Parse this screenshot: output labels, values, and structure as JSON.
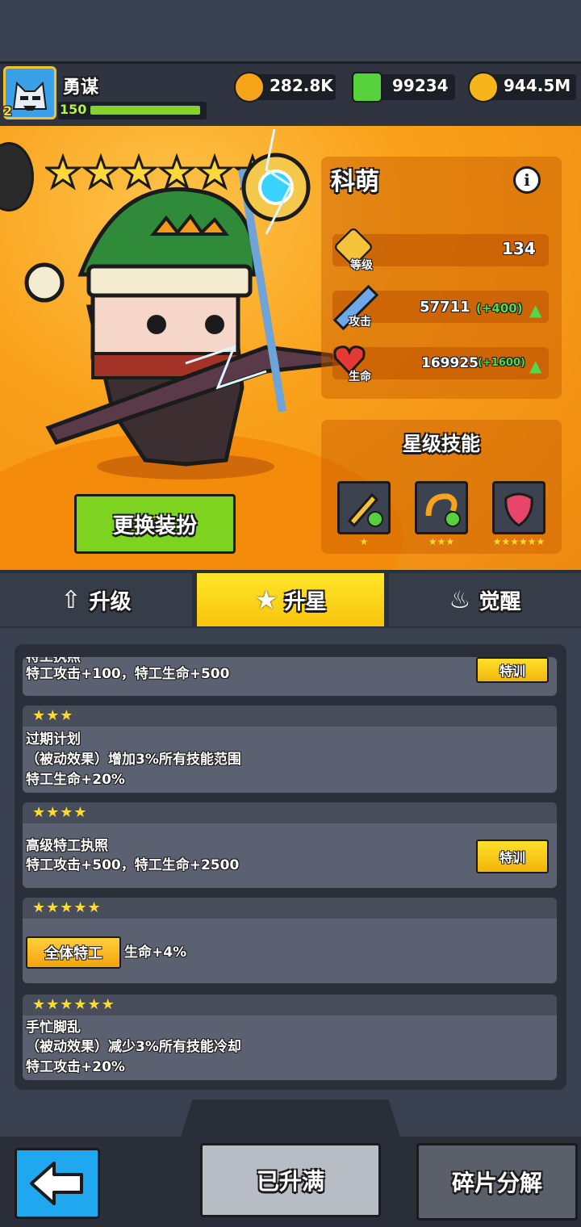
{
  "player": {
    "name": "勇谋",
    "level": "150",
    "vip": "2"
  },
  "resources": [
    {
      "icon": "elixir-drop-icon",
      "value": "282.8K",
      "color": "#f6a41a"
    },
    {
      "icon": "green-gem-icon",
      "value": "99234",
      "color": "#57d13c"
    },
    {
      "icon": "gold-coin-icon",
      "value": "944.5M",
      "color": "#f6b51a"
    }
  ],
  "hero": {
    "name": "科萌",
    "star_count": 6,
    "stats": {
      "level_label": "等级",
      "level_value": "134",
      "attack_label": "攻击",
      "attack_value": "57711",
      "attack_bonus": "(+400)",
      "hp_label": "生命",
      "hp_value": "169925",
      "hp_bonus": "(+1600)"
    },
    "change_outfit_label": "更换装扮"
  },
  "star_skills": {
    "title": "星级技能",
    "skills": [
      {
        "icon": "sword-plus-icon",
        "stars": "★"
      },
      {
        "icon": "swirl-plus-icon",
        "stars": "★★★"
      },
      {
        "icon": "shield-swirl-icon",
        "stars": "★★★★★★"
      }
    ]
  },
  "tabs": [
    {
      "label": "升级",
      "icon": "arrow-up-icon"
    },
    {
      "label": "升星",
      "icon": "star-icon"
    },
    {
      "label": "觉醒",
      "icon": "flame-icon"
    }
  ],
  "star_list": [
    {
      "stars": "",
      "title": "特工执照",
      "lines": [
        "特工攻击+100，特工生命+500"
      ],
      "button": "特训"
    },
    {
      "stars": "★★★",
      "title": "过期计划",
      "lines": [
        "（被动效果）增加3%所有技能范围",
        "特工生命+20%"
      ],
      "button": ""
    },
    {
      "stars": "★★★★",
      "title": "高级特工执照",
      "lines": [
        "特工攻击+500，特工生命+2500"
      ],
      "button": "特训"
    },
    {
      "stars": "★★★★★",
      "tag": "全体特工",
      "effect": "生命+4%"
    },
    {
      "stars": "★★★★★★",
      "title": "手忙脚乱",
      "lines": [
        "（被动效果）减少3%所有技能冷却",
        "特工攻击+20%"
      ]
    }
  ],
  "bottom": {
    "maxed_label": "已升满",
    "shard_label": "碎片分解"
  }
}
